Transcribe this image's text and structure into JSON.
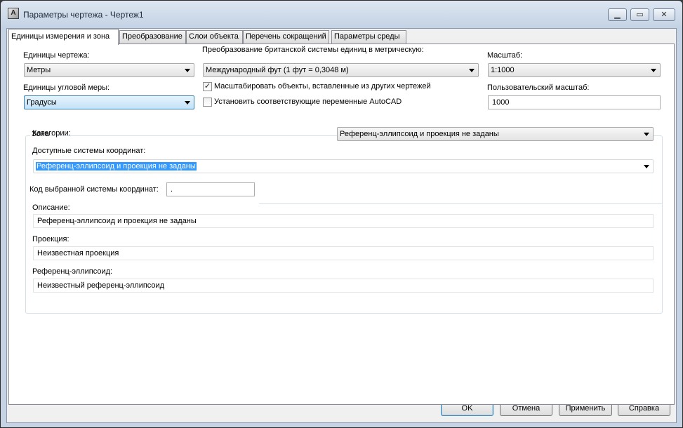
{
  "window": {
    "title": "Параметры чертежа - Чертеж1",
    "icon_name": "autocad-icon"
  },
  "tabs": [
    {
      "label": "Единицы измерения и зона",
      "active": true
    },
    {
      "label": "Преобразование"
    },
    {
      "label": "Слои объекта"
    },
    {
      "label": "Перечень сокращений"
    },
    {
      "label": "Параметры среды"
    }
  ],
  "units": {
    "drawing_units_label": "Единицы чертежа:",
    "drawing_units_value": "Метры",
    "angular_units_label": "Единицы угловой меры:",
    "angular_units_value": "Градусы",
    "imperial_label": "Преобразование британской системы единиц в метрическую:",
    "imperial_value": "Международный фут (1 фут = 0,3048 м)",
    "scale_objects_label": "Масштабировать объекты, вставленные из других чертежей",
    "scale_objects_checked": true,
    "set_vars_label": "Установить соответствующие переменные AutoCAD",
    "set_vars_checked": false,
    "scale_label": "Масштаб:",
    "scale_value": "1:1000",
    "custom_scale_label": "Пользовательский масштаб:",
    "custom_scale_value": "1000"
  },
  "zone": {
    "legend": "Зона",
    "categories_label": "Категории:",
    "categories_value": "Референц-эллипсоид и проекция не заданы",
    "available_cs_label": "Доступные системы координат:",
    "available_cs_value": "Референц-эллипсоид и проекция не заданы",
    "code_label": "Код выбранной системы координат:",
    "code_value": ".",
    "description_label": "Описание:",
    "description_value": "Референц-эллипсоид и проекция не заданы",
    "projection_label": "Проекция:",
    "projection_value": "Неизвестная проекция",
    "ellipsoid_label": "Референц-эллипсоид:",
    "ellipsoid_value": "Неизвестный референц-эллипсоид"
  },
  "buttons": {
    "ok": "OK",
    "cancel": "Отмена",
    "apply": "Применить",
    "help": "Справка"
  }
}
